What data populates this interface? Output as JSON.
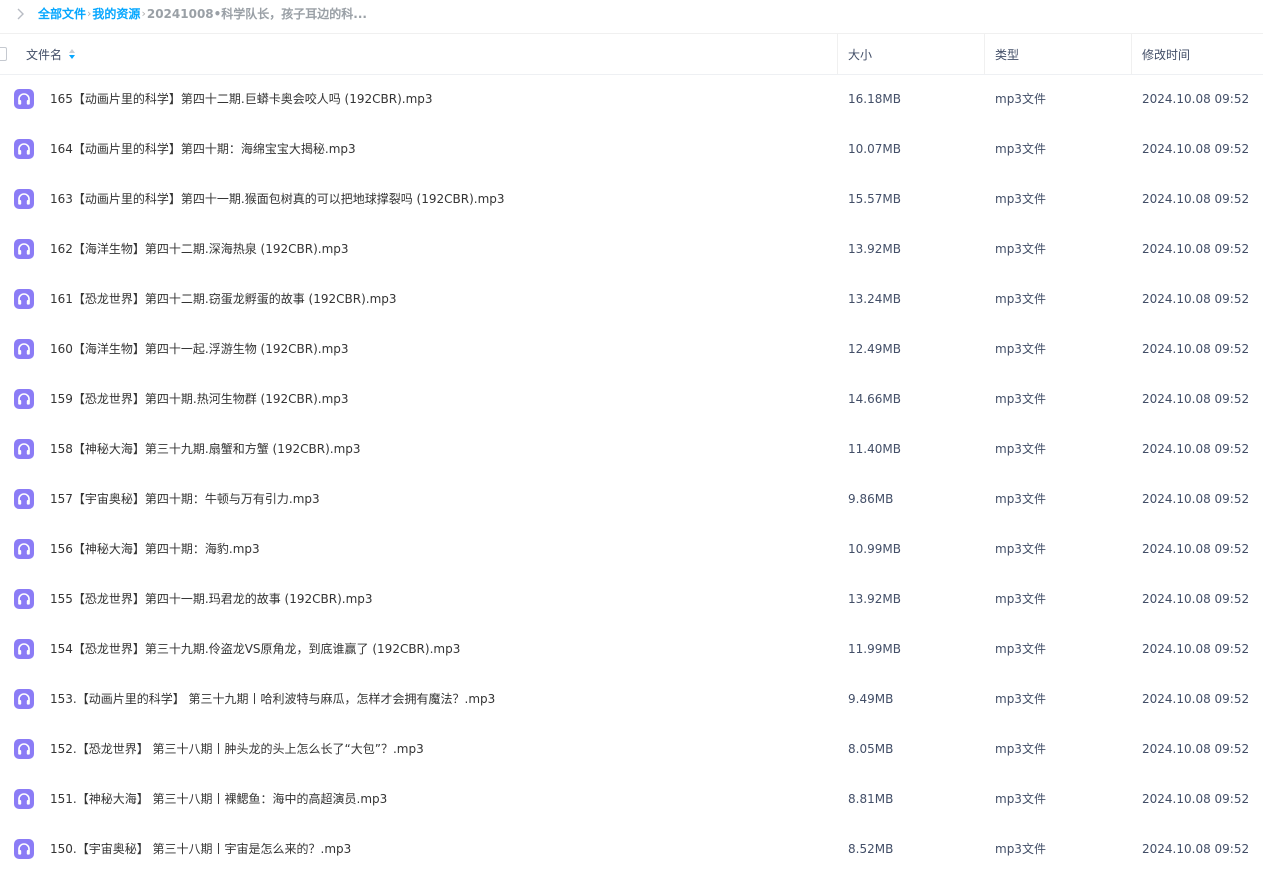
{
  "breadcrumb": {
    "items": [
      "全部文件",
      "我的资源"
    ],
    "separator": "›",
    "current": "20241008•科学队长，孩子耳边的科..."
  },
  "header": {
    "name": "文件名",
    "size": "大小",
    "type": "类型",
    "mtime": "修改时间"
  },
  "colors": {
    "accent": "#06a7ff",
    "file_icon": "#8b7cf6"
  },
  "icons": {
    "back": "chevron-right-icon",
    "sort": "sort-icon",
    "file": "audio-file-icon"
  },
  "files": [
    {
      "name": "165【动画片里的科学】第四十二期.巨蟒卡奥会咬人吗 (192CBR).mp3",
      "size": "16.18MB",
      "type": "mp3文件",
      "mtime": "2024.10.08 09:52"
    },
    {
      "name": "164【动画片里的科学】第四十期：海绵宝宝大揭秘.mp3",
      "size": "10.07MB",
      "type": "mp3文件",
      "mtime": "2024.10.08 09:52"
    },
    {
      "name": "163【动画片里的科学】第四十一期.猴面包树真的可以把地球撑裂吗 (192CBR).mp3",
      "size": "15.57MB",
      "type": "mp3文件",
      "mtime": "2024.10.08 09:52"
    },
    {
      "name": "162【海洋生物】第四十二期.深海热泉 (192CBR).mp3",
      "size": "13.92MB",
      "type": "mp3文件",
      "mtime": "2024.10.08 09:52"
    },
    {
      "name": "161【恐龙世界】第四十二期.窃蛋龙孵蛋的故事 (192CBR).mp3",
      "size": "13.24MB",
      "type": "mp3文件",
      "mtime": "2024.10.08 09:52"
    },
    {
      "name": "160【海洋生物】第四十一起.浮游生物 (192CBR).mp3",
      "size": "12.49MB",
      "type": "mp3文件",
      "mtime": "2024.10.08 09:52"
    },
    {
      "name": "159【恐龙世界】第四十期.热河生物群 (192CBR).mp3",
      "size": "14.66MB",
      "type": "mp3文件",
      "mtime": "2024.10.08 09:52"
    },
    {
      "name": "158【神秘大海】第三十九期.扇蟹和方蟹 (192CBR).mp3",
      "size": "11.40MB",
      "type": "mp3文件",
      "mtime": "2024.10.08 09:52"
    },
    {
      "name": "157【宇宙奥秘】第四十期：牛顿与万有引力.mp3",
      "size": "9.86MB",
      "type": "mp3文件",
      "mtime": "2024.10.08 09:52"
    },
    {
      "name": "156【神秘大海】第四十期：海豹.mp3",
      "size": "10.99MB",
      "type": "mp3文件",
      "mtime": "2024.10.08 09:52"
    },
    {
      "name": "155【恐龙世界】第四十一期.玛君龙的故事 (192CBR).mp3",
      "size": "13.92MB",
      "type": "mp3文件",
      "mtime": "2024.10.08 09:52"
    },
    {
      "name": "154【恐龙世界】第三十九期.伶盗龙VS原角龙，到底谁赢了 (192CBR).mp3",
      "size": "11.99MB",
      "type": "mp3文件",
      "mtime": "2024.10.08 09:52"
    },
    {
      "name": "153.【动画片里的科学】 第三十九期丨哈利波特与麻瓜，怎样才会拥有魔法？.mp3",
      "size": "9.49MB",
      "type": "mp3文件",
      "mtime": "2024.10.08 09:52"
    },
    {
      "name": "152.【恐龙世界】 第三十八期丨肿头龙的头上怎么长了“大包”？.mp3",
      "size": "8.05MB",
      "type": "mp3文件",
      "mtime": "2024.10.08 09:52"
    },
    {
      "name": "151.【神秘大海】 第三十八期丨裸鳃鱼：海中的高超演员.mp3",
      "size": "8.81MB",
      "type": "mp3文件",
      "mtime": "2024.10.08 09:52"
    },
    {
      "name": "150.【宇宙奥秘】 第三十八期丨宇宙是怎么来的？.mp3",
      "size": "8.52MB",
      "type": "mp3文件",
      "mtime": "2024.10.08 09:52"
    }
  ]
}
